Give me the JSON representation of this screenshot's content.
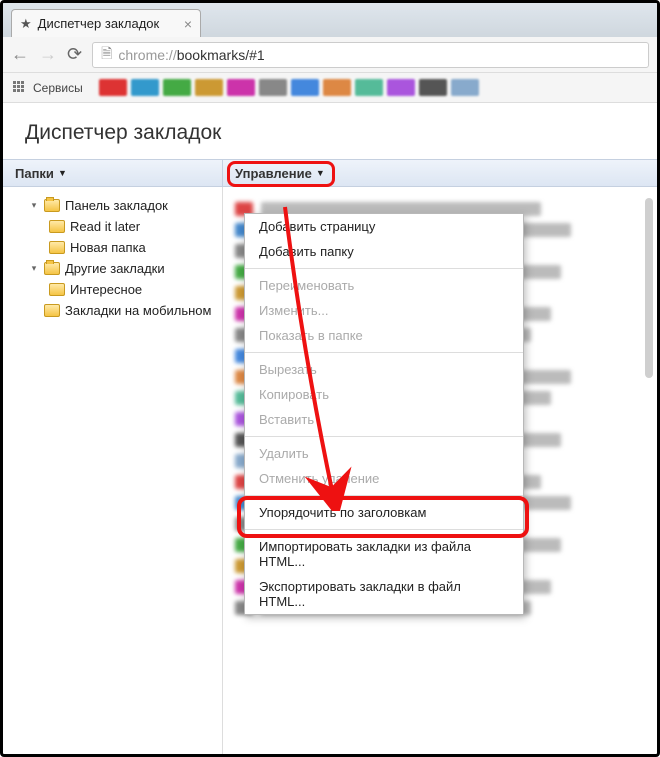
{
  "tab": {
    "title": "Диспетчер закладок"
  },
  "url": {
    "scheme": "chrome://",
    "path": "bookmarks/#1"
  },
  "bookmarks_bar": {
    "services_label": "Сервисы"
  },
  "page": {
    "title": "Диспетчер закладок"
  },
  "header": {
    "folders_label": "Папки",
    "manage_label": "Управление"
  },
  "tree": [
    {
      "label": "Панель закладок",
      "expanded": true,
      "depth": 1
    },
    {
      "label": "Read it later",
      "depth": 2
    },
    {
      "label": "Новая папка",
      "depth": 2
    },
    {
      "label": "Другие закладки",
      "expanded": true,
      "depth": 1
    },
    {
      "label": "Интересное",
      "depth": 2
    },
    {
      "label": "Закладки на мобильном",
      "depth": 1
    }
  ],
  "menu": {
    "items": [
      {
        "label": "Добавить страницу",
        "enabled": true
      },
      {
        "label": "Добавить папку",
        "enabled": true
      },
      {
        "sep": true
      },
      {
        "label": "Переименовать",
        "enabled": false
      },
      {
        "label": "Изменить...",
        "enabled": false
      },
      {
        "label": "Показать в папке",
        "enabled": false
      },
      {
        "sep": true
      },
      {
        "label": "Вырезать",
        "enabled": false
      },
      {
        "label": "Копировать",
        "enabled": false
      },
      {
        "label": "Вставить",
        "enabled": false
      },
      {
        "sep": true
      },
      {
        "label": "Удалить",
        "enabled": false
      },
      {
        "label": "Отменить удаление",
        "enabled": false
      },
      {
        "sep": true
      },
      {
        "label": "Упорядочить по заголовкам",
        "enabled": true
      },
      {
        "sep": true
      },
      {
        "label": "Импортировать закладки из файла HTML...",
        "enabled": true
      },
      {
        "label": "Экспортировать закладки в файл HTML...",
        "enabled": true
      }
    ]
  }
}
